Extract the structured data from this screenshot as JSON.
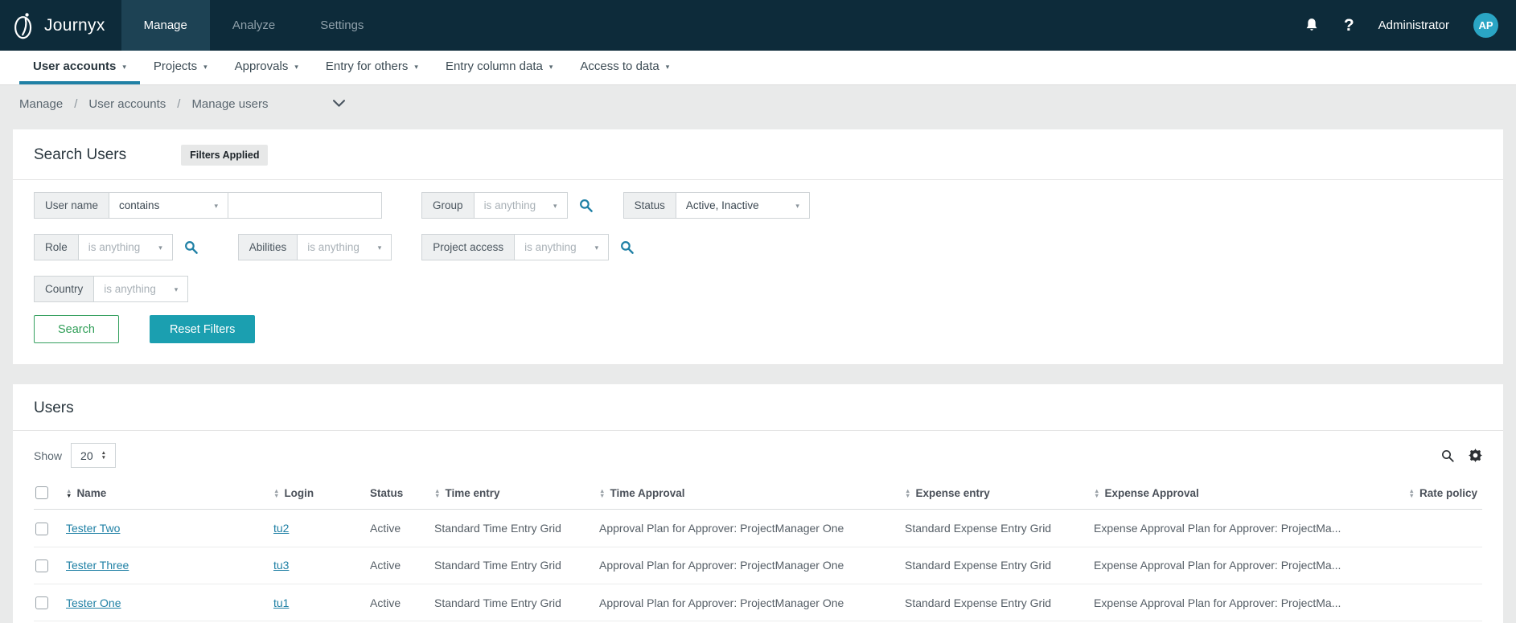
{
  "colors": {
    "navbar_bg": "#0d2b3a",
    "active_tab_bg": "#1d4254",
    "accent_blue": "#1f80a5",
    "avatar_bg": "#2aa5c4",
    "teal_button": "#1b9fb0",
    "green_button": "#2f9e57"
  },
  "topnav": {
    "brand": "Journyx",
    "tabs": [
      {
        "label": "Manage",
        "active": true
      },
      {
        "label": "Analyze",
        "active": false
      },
      {
        "label": "Settings",
        "active": false
      }
    ],
    "user": "Administrator",
    "avatar_initials": "AP"
  },
  "subnav": {
    "active": "User accounts",
    "items": [
      "User accounts",
      "Projects",
      "Approvals",
      "Entry for others",
      "Entry column data",
      "Access to data"
    ]
  },
  "breadcrumb": {
    "items": [
      "Manage",
      "User accounts",
      "Manage users"
    ]
  },
  "search_panel": {
    "title": "Search Users",
    "badge": "Filters Applied",
    "filters": {
      "user_name": {
        "label": "User name",
        "operator": "contains",
        "value": ""
      },
      "group": {
        "label": "Group",
        "value": "is anything"
      },
      "status": {
        "label": "Status",
        "value": "Active, Inactive"
      },
      "role": {
        "label": "Role",
        "value": "is anything"
      },
      "abilities": {
        "label": "Abilities",
        "value": "is anything"
      },
      "project_access": {
        "label": "Project access",
        "value": "is anything"
      },
      "country": {
        "label": "Country",
        "value": "is anything"
      }
    },
    "buttons": {
      "search": "Search",
      "reset": "Reset Filters"
    }
  },
  "users_panel": {
    "title": "Users",
    "show_label": "Show",
    "page_size": "20",
    "columns": [
      {
        "label": "Name",
        "sortable": true,
        "sorted": "desc"
      },
      {
        "label": "Login",
        "sortable": true
      },
      {
        "label": "Status",
        "sortable": false
      },
      {
        "label": "Time entry",
        "sortable": true
      },
      {
        "label": "Time Approval",
        "sortable": true
      },
      {
        "label": "Expense entry",
        "sortable": true
      },
      {
        "label": "Expense Approval",
        "sortable": true
      },
      {
        "label": "Rate policy",
        "sortable": true,
        "align": "right"
      }
    ],
    "rows": [
      {
        "name": "Tester Two",
        "login": "tu2",
        "status": "Active",
        "time_entry": "Standard Time Entry Grid",
        "time_approval": "Approval Plan for Approver: ProjectManager One",
        "expense_entry": "Standard Expense Entry Grid",
        "expense_approval": "Expense Approval Plan for Approver: ProjectMa...",
        "rate_policy": ""
      },
      {
        "name": "Tester Three",
        "login": "tu3",
        "status": "Active",
        "time_entry": "Standard Time Entry Grid",
        "time_approval": "Approval Plan for Approver: ProjectManager One",
        "expense_entry": "Standard Expense Entry Grid",
        "expense_approval": "Expense Approval Plan for Approver: ProjectMa...",
        "rate_policy": ""
      },
      {
        "name": "Tester One",
        "login": "tu1",
        "status": "Active",
        "time_entry": "Standard Time Entry Grid",
        "time_approval": "Approval Plan for Approver: ProjectManager One",
        "expense_entry": "Standard Expense Entry Grid",
        "expense_approval": "Expense Approval Plan for Approver: ProjectMa...",
        "rate_policy": ""
      }
    ]
  }
}
